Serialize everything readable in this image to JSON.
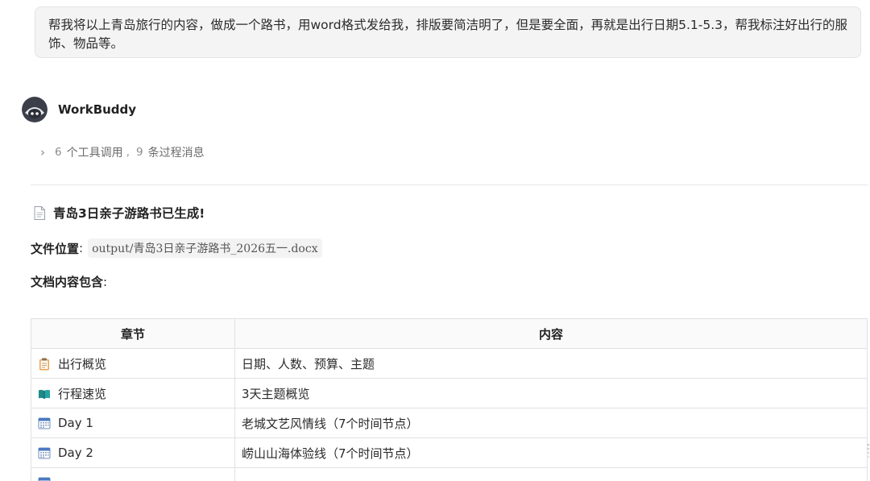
{
  "user_message": "帮我将以上青岛旅行的内容，做成一个路书，用word格式发给我，排版要简洁明了，但是要全面，再就是出行日期5.1-5.3，帮我标注好出行的服饰、物品等。",
  "assistant": {
    "name": "WorkBuddy",
    "avatar_icon": "robot-avatar-icon"
  },
  "tool_summary": {
    "chevron_icon": "chevron-right-icon",
    "tool_count": "6",
    "tool_label": "个工具调用",
    "separator": ",",
    "message_count": "9",
    "message_label": "条过程消息"
  },
  "result": {
    "doc_icon": "document-icon",
    "title": "青岛3日亲子游路书已生成!",
    "file_label": "文件位置",
    "colon": ":",
    "file_path": "output/青岛3日亲子游路书_2026五一.docx",
    "contents_label": "文档内容包含",
    "contents_colon": ":"
  },
  "table": {
    "headers": [
      "章节",
      "内容"
    ],
    "rows": [
      {
        "icon": "clipboard-icon",
        "section": "出行概览",
        "content": "日期、人数、预算、主题"
      },
      {
        "icon": "book-icon",
        "section": "行程速览",
        "content": "3天主题概览"
      },
      {
        "icon": "calendar-icon",
        "section": "Day 1",
        "content": "老城文艺风情线（7个时间节点）"
      },
      {
        "icon": "calendar-icon",
        "section": "Day 2",
        "content": "崂山山海体验线（7个时间节点）"
      },
      {
        "icon": "calendar-icon",
        "section": "",
        "content": ""
      }
    ]
  },
  "colors": {
    "bubble_bg": "#f4f4f5",
    "border": "#e1e1e1",
    "text": "#1f1f1f",
    "muted": "#6b6b6b"
  }
}
